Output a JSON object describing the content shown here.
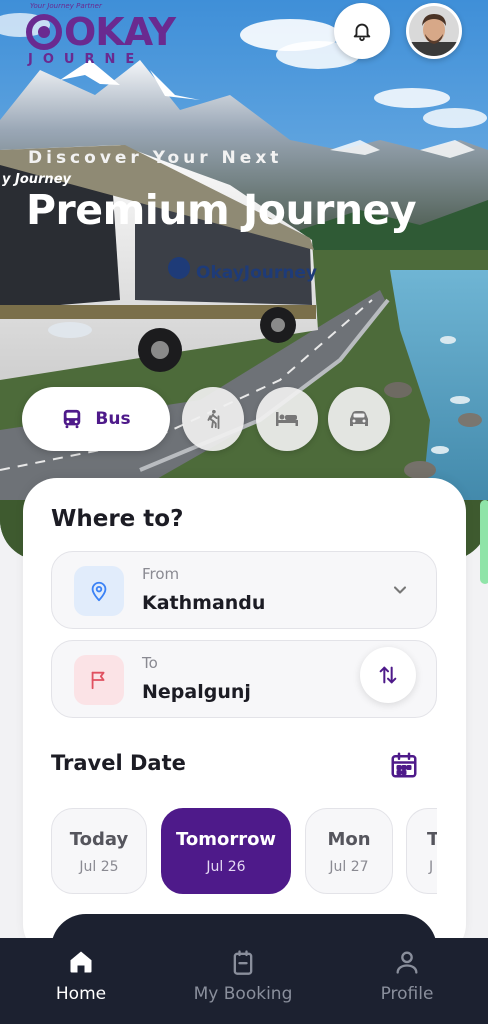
{
  "colors": {
    "brand": "#4e1a8a",
    "logo": "#6a2a90",
    "dark": "#1c2130",
    "from_icon": "#3b82f6",
    "to_icon": "#e05060"
  },
  "header": {
    "logo_word": "OKAY",
    "logo_sub": "JOURNE",
    "logo_tagline": "Your Journey Partner",
    "bell_icon": "bell-icon",
    "avatar_icon": "user-avatar"
  },
  "hero": {
    "kicker": "Discover Your Next",
    "title": "Premium Journey",
    "bus_brand": "OkayJourney",
    "windshield_text": "y Journey"
  },
  "modes": [
    {
      "label": "Bus",
      "icon": "bus-icon",
      "selected": true
    },
    {
      "label": "",
      "icon": "hiking-icon",
      "selected": false
    },
    {
      "label": "",
      "icon": "bed-icon",
      "selected": false
    },
    {
      "label": "",
      "icon": "car-icon",
      "selected": false
    }
  ],
  "search": {
    "title": "Where to?",
    "from": {
      "label": "From",
      "value": "Kathmandu",
      "icon": "location-pin-icon"
    },
    "to": {
      "label": "To",
      "value": "Nepalgunj",
      "icon": "flag-icon"
    },
    "swap_icon": "swap-icon",
    "date_title": "Travel Date",
    "calendar_icon": "calendar-icon",
    "dates": [
      {
        "day": "Today",
        "date": "Jul 25",
        "active": false
      },
      {
        "day": "Tomorrow",
        "date": "Jul 26",
        "active": true
      },
      {
        "day": "Mon",
        "date": "Jul 27",
        "active": false
      },
      {
        "day": "T",
        "date": "J",
        "active": false
      }
    ]
  },
  "nav": [
    {
      "label": "Home",
      "icon": "home-icon",
      "active": true
    },
    {
      "label": "My Booking",
      "icon": "booking-icon",
      "active": false
    },
    {
      "label": "Profile",
      "icon": "profile-icon",
      "active": false
    }
  ]
}
